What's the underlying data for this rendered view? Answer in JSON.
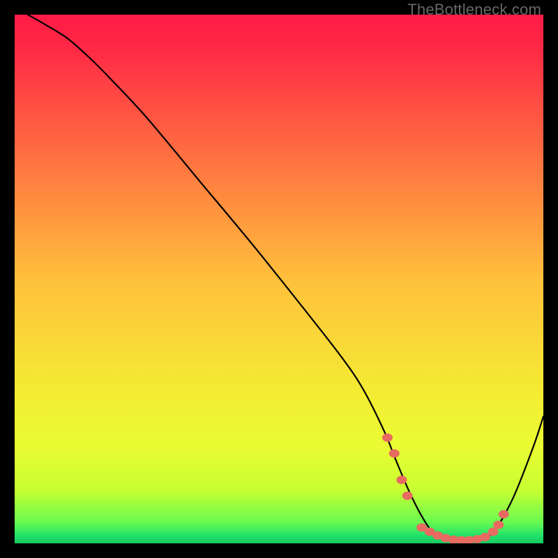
{
  "watermark": "TheBottleneck.com",
  "chart_data": {
    "type": "line",
    "title": "",
    "xlabel": "",
    "ylabel": "",
    "xlim": [
      0,
      100
    ],
    "ylim": [
      0,
      100
    ],
    "gradient_stops": [
      {
        "offset": 0.0,
        "color": "#ff1b45"
      },
      {
        "offset": 0.06,
        "color": "#ff2845"
      },
      {
        "offset": 0.5,
        "color": "#ffc03c"
      },
      {
        "offset": 0.72,
        "color": "#f4ed33"
      },
      {
        "offset": 0.82,
        "color": "#e9fc33"
      },
      {
        "offset": 0.9,
        "color": "#c7ff32"
      },
      {
        "offset": 0.96,
        "color": "#68fa50"
      },
      {
        "offset": 0.985,
        "color": "#22e26a"
      },
      {
        "offset": 1.0,
        "color": "#17c95e"
      }
    ],
    "series": [
      {
        "name": "bottleneck-curve",
        "x": [
          2.5,
          6,
          10,
          14,
          18,
          25,
          35,
          45,
          55,
          62,
          66,
          70,
          72,
          75,
          78,
          80,
          83,
          86,
          90,
          94,
          98,
          100
        ],
        "y": [
          100,
          98,
          95.5,
          92,
          88,
          80.5,
          68.5,
          56.5,
          44,
          35,
          29,
          21,
          16,
          9,
          3.5,
          1.5,
          0.6,
          0.6,
          1.6,
          8,
          18,
          24
        ]
      }
    ],
    "markers": {
      "name": "highlight-dots",
      "color": "#e86a61",
      "points": [
        {
          "x": 70.5,
          "y": 20
        },
        {
          "x": 71.8,
          "y": 17
        },
        {
          "x": 73.2,
          "y": 12
        },
        {
          "x": 74.3,
          "y": 9
        },
        {
          "x": 77.0,
          "y": 3.0
        },
        {
          "x": 78.5,
          "y": 2.2
        },
        {
          "x": 80.0,
          "y": 1.5
        },
        {
          "x": 81.5,
          "y": 1.0
        },
        {
          "x": 83.0,
          "y": 0.7
        },
        {
          "x": 84.5,
          "y": 0.6
        },
        {
          "x": 86.0,
          "y": 0.6
        },
        {
          "x": 87.5,
          "y": 0.8
        },
        {
          "x": 89.0,
          "y": 1.2
        },
        {
          "x": 90.5,
          "y": 2.2
        },
        {
          "x": 91.5,
          "y": 3.5
        },
        {
          "x": 92.5,
          "y": 5.5
        }
      ]
    }
  }
}
